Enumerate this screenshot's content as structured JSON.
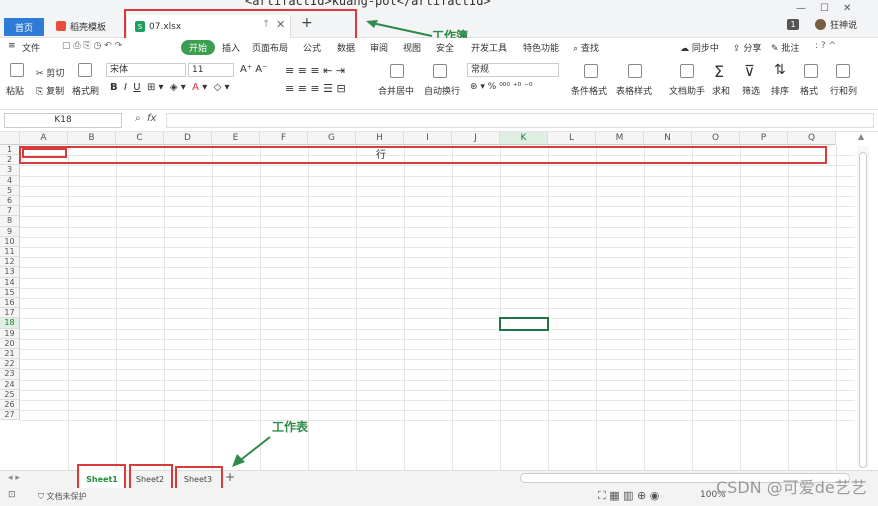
{
  "titlebar": {
    "home_tab": "首页",
    "template_tab": "稻壳模板",
    "file_tab": "07.xlsx",
    "code_snippet": "<artifactId>kuang-pot</artifactId>",
    "user_name": "狂神说",
    "badge": "1"
  },
  "menubar": {
    "file": "文件",
    "items": [
      "开始",
      "插入",
      "页面布局",
      "公式",
      "数据",
      "审阅",
      "视图",
      "安全",
      "开发工具",
      "特色功能"
    ],
    "search": "查找",
    "sync": "同步中",
    "share": "分享",
    "comment": "批注"
  },
  "ribbon": {
    "paste": "粘贴",
    "cut": "剪切",
    "copy": "复制",
    "format_painter": "格式刷",
    "font_name": "宋体",
    "font_size": "11",
    "merge_center": "合并居中",
    "wrap_text": "自动换行",
    "number_format": "常规",
    "conditional_format": "条件格式",
    "table_style": "表格样式",
    "doc_assistant": "文档助手",
    "sum": "求和",
    "filter": "筛选",
    "sort": "排序",
    "format": "格式",
    "row_col": "行和列"
  },
  "formula": {
    "cell_ref": "K18",
    "fx": "fx"
  },
  "grid": {
    "columns": [
      "A",
      "B",
      "C",
      "D",
      "E",
      "F",
      "G",
      "H",
      "I",
      "J",
      "K",
      "L",
      "M",
      "N",
      "O",
      "P",
      "Q"
    ],
    "rows": [
      "1",
      "2",
      "3",
      "4",
      "5",
      "6",
      "7",
      "8",
      "9",
      "10",
      "11",
      "12",
      "13",
      "14",
      "15",
      "16",
      "17",
      "18",
      "19",
      "20",
      "21",
      "22",
      "23",
      "24",
      "25",
      "26",
      "27"
    ],
    "selected_col": "K",
    "selected_row": "18",
    "row_annotation": "行"
  },
  "annotations": {
    "workbook": "工作簿",
    "worksheet": "工作表"
  },
  "sheets": {
    "tabs": [
      "Sheet1",
      "Sheet2",
      "Sheet3"
    ],
    "add": "+"
  },
  "status": {
    "protect": "文档未保护",
    "zoom": "100%"
  },
  "watermark": "CSDN @可爱de艺艺",
  "colors": {
    "accent_green": "#217346",
    "annotation_red": "#d93a3a",
    "home_blue": "#2d7bd6"
  }
}
